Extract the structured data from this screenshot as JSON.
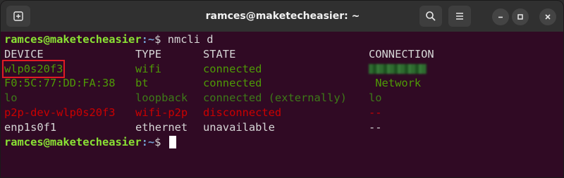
{
  "window": {
    "title": "ramces@maketecheasier: ~"
  },
  "titlebar": {
    "new_tab_icon": "new-tab-plus-icon",
    "search_icon": "search-icon",
    "menu_icon": "hamburger-menu-icon",
    "minimize_icon": "minimize-icon",
    "maximize_icon": "maximize-icon",
    "close_icon": "close-icon"
  },
  "colors": {
    "terminal_bg": "#300a24",
    "prompt_user": "#8ae234",
    "prompt_path": "#729fcf",
    "connected": "#4e9a06",
    "disconnected": "#cc0000",
    "highlight_box": "#e01b24"
  },
  "terminal": {
    "prompt1": {
      "user_host": "ramces@maketecheasier",
      "path": ":~",
      "symbol": "$",
      "command": " nmcli d"
    },
    "headers": {
      "device": "DEVICE",
      "type": "TYPE",
      "state": "STATE",
      "connection": "CONNECTION"
    },
    "rows": [
      {
        "device": "wlp0s20f3",
        "type": "wifi",
        "state": "connected",
        "connection": "[redacted]"
      },
      {
        "device": "F0:5C:77:DD:FA:38",
        "type": "bt",
        "state": "connected",
        "connection": " Network"
      },
      {
        "device": "lo",
        "type": "loopback",
        "state": "connected (externally)",
        "connection": "lo"
      },
      {
        "device": "p2p-dev-wlp0s20f3",
        "type": "wifi-p2p",
        "state": "disconnected",
        "connection": "--"
      },
      {
        "device": "enp1s0f1",
        "type": "ethernet",
        "state": "unavailable",
        "connection": "--"
      }
    ],
    "prompt2": {
      "user_host": "ramces@maketecheasier",
      "path": ":~",
      "symbol": "$"
    }
  }
}
